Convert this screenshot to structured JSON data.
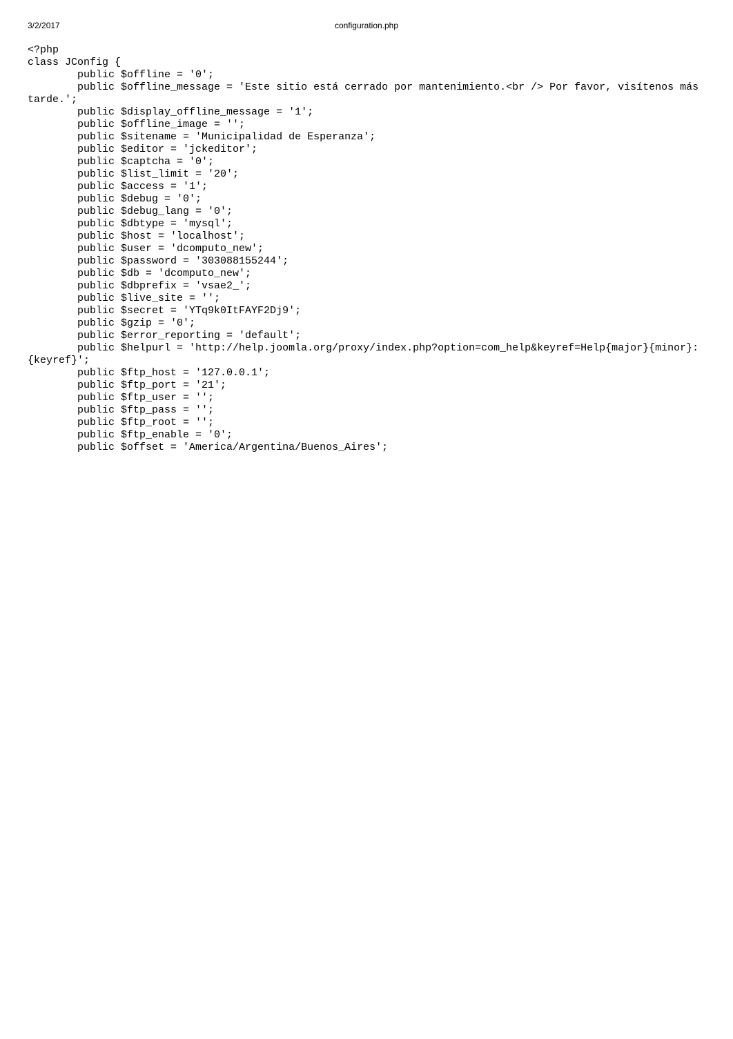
{
  "header": {
    "date": "3/2/2017",
    "title": "configuration.php"
  },
  "code": "<?php\nclass JConfig {\n        public $offline = '0';\n        public $offline_message = 'Este sitio está cerrado por mantenimiento.<br /> Por favor, visítenos más tarde.';\n        public $display_offline_message = '1';\n        public $offline_image = '';\n        public $sitename = 'Municipalidad de Esperanza';\n        public $editor = 'jckeditor';\n        public $captcha = '0';\n        public $list_limit = '20';\n        public $access = '1';\n        public $debug = '0';\n        public $debug_lang = '0';\n        public $dbtype = 'mysql';\n        public $host = 'localhost';\n        public $user = 'dcomputo_new';\n        public $password = '303088155244';\n        public $db = 'dcomputo_new';\n        public $dbprefix = 'vsae2_';\n        public $live_site = '';\n        public $secret = 'YTq9k0ItFAYF2Dj9';\n        public $gzip = '0';\n        public $error_reporting = 'default';\n        public $helpurl = 'http://help.joomla.org/proxy/index.php?option=com_help&keyref=Help{major}{minor}:{keyref}';\n        public $ftp_host = '127.0.0.1';\n        public $ftp_port = '21';\n        public $ftp_user = '';\n        public $ftp_pass = '';\n        public $ftp_root = '';\n        public $ftp_enable = '0';\n        public $offset = 'America/Argentina/Buenos_Aires';"
}
